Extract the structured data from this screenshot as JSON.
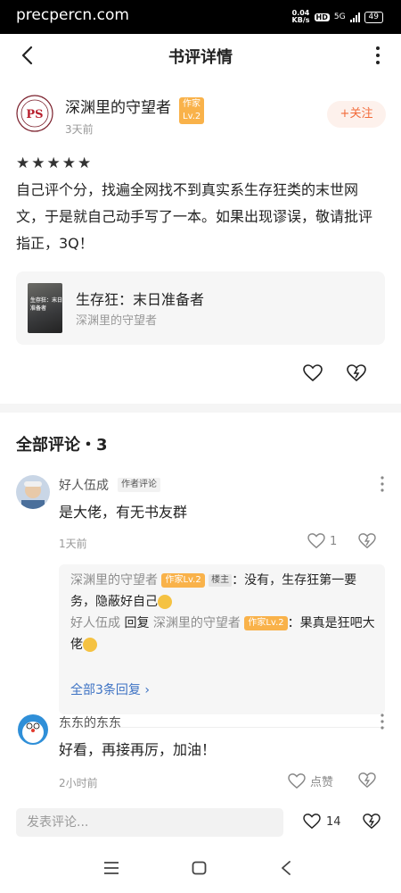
{
  "status_bar": {
    "watermark": "precpercn.com",
    "net_speed_top": "0.04",
    "net_speed_unit": "KB/s",
    "hd": "HD",
    "network": "5G",
    "battery": "49"
  },
  "header": {
    "title": "书评详情"
  },
  "author": {
    "name": "深渊里的守望者",
    "level": "作家Lv.2",
    "time": "3天前",
    "follow_label": "+关注"
  },
  "rating": {
    "stars": 5,
    "max": 5
  },
  "review_text": "自己评个分，找遍全网找不到真实系生存狂类的末世网文，于是就自己动手写了一本。如果出现谬误，敬请批评指正，3Q！",
  "book": {
    "title": "生存狂：末日准备者",
    "author": "深渊里的守望者",
    "cover_text": "生存狂：末日准备者"
  },
  "comments_header": "全部评论・3",
  "comments": [
    {
      "user": "好人伍成",
      "tag": "作者评论",
      "text": "是大佬，有无书友群",
      "time": "1天前",
      "likes": "1"
    },
    {
      "user": "东东的东东",
      "tag": "",
      "text": "好看，再接再厉，加油！",
      "time": "2小时前",
      "likes": "点赞"
    }
  ],
  "replies": {
    "r1": {
      "user": "深渊里的守望者",
      "level": "作家Lv.2",
      "host_tag": "楼主",
      "text": "：没有，生存狂第一要务，隐蔽好自己"
    },
    "r2": {
      "user": "好人伍成",
      "reply_word": "回复",
      "target": "深渊里的守望者",
      "level": "作家Lv.2",
      "text": "：果真是狂吧大佬"
    },
    "more": "全部3条回复 ›"
  },
  "bottom": {
    "placeholder": "发表评论...",
    "like_count": "14"
  },
  "colors": {
    "accent": "#f26b3a",
    "level_badge": "#f9b24a",
    "link": "#3e73c4"
  }
}
